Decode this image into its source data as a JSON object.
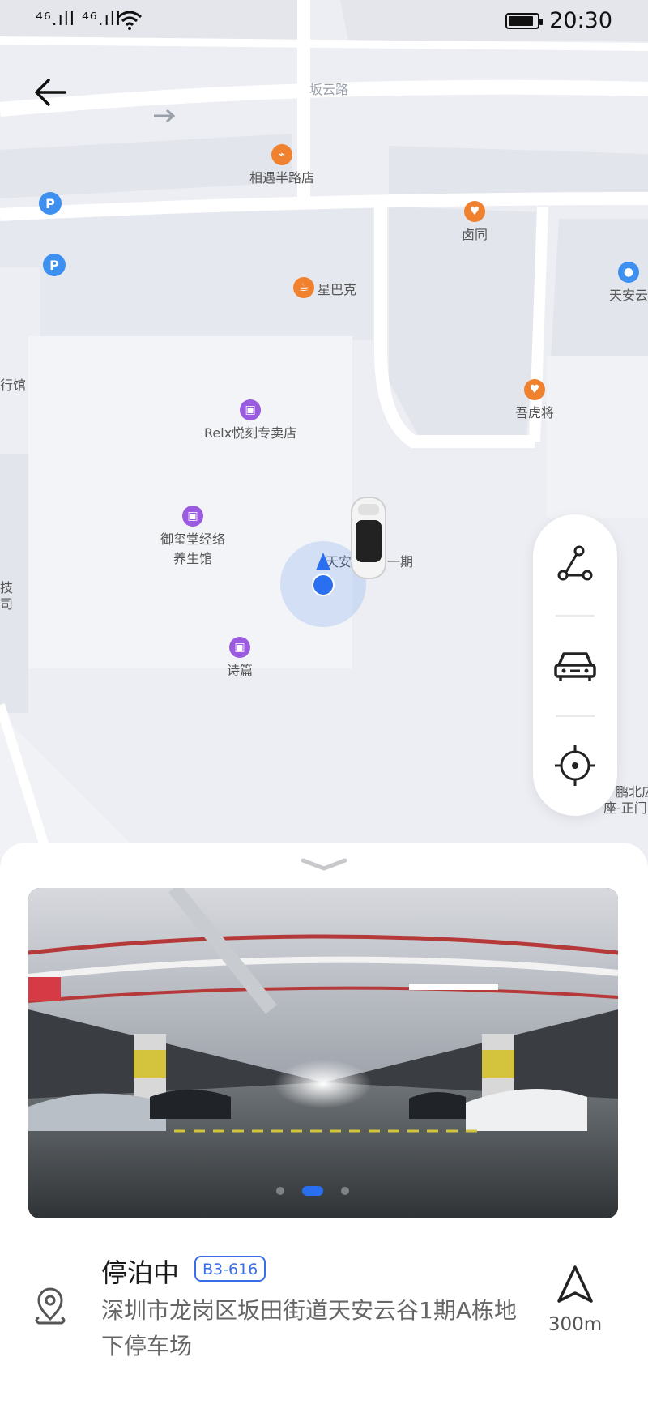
{
  "status_bar": {
    "signal_text": "⁴⁶.ıll ⁴⁶.ıll",
    "time": "20:30",
    "icons": [
      "signal-icon",
      "wifi-icon",
      "battery-icon"
    ]
  },
  "map": {
    "road_label": "坂云路",
    "pois": [
      {
        "label": "相遇半路店",
        "icon": "food-icon",
        "color": "#f0812f"
      },
      {
        "label": "卤同",
        "icon": "food-icon",
        "color": "#f0812f"
      },
      {
        "label": "星巴克",
        "icon": "coffee-icon",
        "color": "#f0812f"
      },
      {
        "label": "天安云",
        "icon": "building-icon",
        "color": "#3d8ff0"
      },
      {
        "label": "行馆",
        "icon": "",
        "color": ""
      },
      {
        "label": "吾虎将",
        "icon": "food-icon",
        "color": "#f0812f"
      },
      {
        "label": "Relx悦刻专卖店",
        "icon": "shop-icon",
        "color": "#9a5be0"
      },
      {
        "label": "御玺堂经络",
        "icon": "shop-icon",
        "color": "#9a5be0"
      },
      {
        "label": "养生馆",
        "icon": "",
        "color": ""
      },
      {
        "label": "诗篇",
        "icon": "shop-icon",
        "color": "#9a5be0"
      },
      {
        "label": "天安",
        "icon": "",
        "color": ""
      },
      {
        "label": "一期",
        "icon": "",
        "color": ""
      },
      {
        "label": "技",
        "icon": "",
        "color": ""
      },
      {
        "label": "司",
        "icon": "",
        "color": ""
      },
      {
        "label": "鹏北広",
        "icon": "",
        "color": ""
      },
      {
        "label": "座-正门",
        "icon": "",
        "color": ""
      }
    ],
    "parking_markers": [
      "parking-icon",
      "parking-icon"
    ]
  },
  "controls": {
    "route_icon": "route-icon",
    "car_icon": "car-icon",
    "locate_icon": "locate-icon"
  },
  "sheet": {
    "handle_icon": "chevron-down-icon",
    "photo_pages": 3,
    "photo_active_page": 2,
    "title": "停泊中",
    "badge": "B3-616",
    "address": "深圳市龙岗区坂田街道天安云谷1期A栋地下停车场",
    "nav_icon": "navigate-icon",
    "distance": "300m"
  },
  "colors": {
    "accent": "#3a6ee8",
    "location_dot": "#2a6ff0",
    "map_bg": "#eceef3",
    "road": "#ffffff"
  }
}
